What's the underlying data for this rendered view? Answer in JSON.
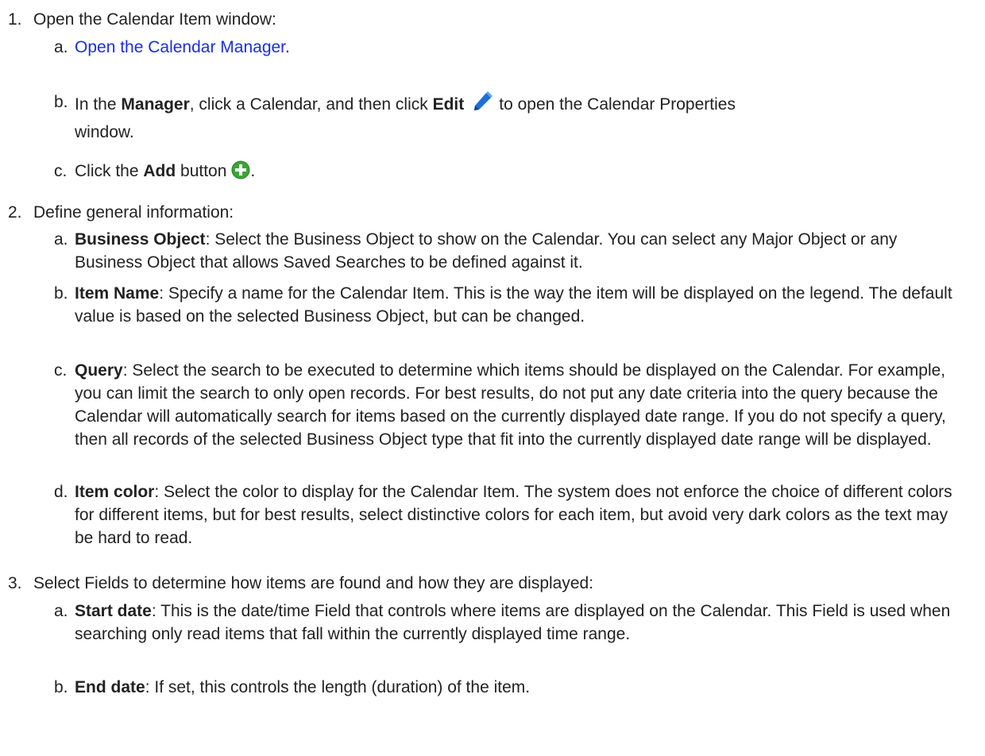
{
  "steps": [
    {
      "num": "1.",
      "title": "Open the Calendar Item window:",
      "items": [
        {
          "label": "a.",
          "link": "Open the Calendar Manager",
          "after": "."
        },
        {
          "label": "b.",
          "t1": "In the ",
          "b1": "Manager",
          "t2": ", click a Calendar, and then click ",
          "b2": "Edit",
          "t3": "to open the Calendar Properties",
          "t4": "window.",
          "icon": "edit-pencil-icon"
        },
        {
          "label": "c.",
          "t1": "Click the ",
          "b1": "Add",
          "t2": " button",
          "after": ".",
          "icon": "add-plus-icon"
        }
      ]
    },
    {
      "num": "2.",
      "title": "Define general information:",
      "items": [
        {
          "label": "a.",
          "term": "Business Object",
          "text": ": Select the Business Object to show on the Calendar. You can select any Major Object or any Business Object that allows Saved Searches to be defined against it."
        },
        {
          "label": "b.",
          "term": "Item Name",
          "text": ": Specify a name for the Calendar Item. This is the way the item will be displayed on the legend. The default value is based on the selected Business Object, but can be changed."
        },
        {
          "label": "c.",
          "term": "Query",
          "text": ": Select the search to be executed to determine which items should be displayed on the Calendar. For example, you can limit the search to only open records. For best results, do not put any date criteria into the query because the Calendar will automatically search for items based on the currently displayed date range. If you do not specify a query, then all records of the selected Business Object type that fit into the currently displayed date range will be displayed."
        },
        {
          "label": "d.",
          "term": "Item color",
          "text": ": Select the color to display for the Calendar Item. The system does not enforce the choice of different colors for different items, but for best results, select distinctive colors for each item, but avoid very dark colors as the text may be hard to read."
        }
      ]
    },
    {
      "num": "3.",
      "title": "Select Fields to determine how items are found and how they are displayed:",
      "items": [
        {
          "label": "a.",
          "term": "Start date",
          "text": ": This is the date/time Field that controls where items are displayed on the Calendar. This Field is used when searching only read items that fall within the currently displayed time range."
        },
        {
          "label": "b.",
          "term": "End date",
          "text": ": If set, this controls the length (duration) of the item."
        }
      ]
    }
  ],
  "colors": {
    "link": "#1a2fe0",
    "text": "#222222",
    "icon_blue": "#1f6fd8",
    "icon_green": "#3aa635"
  }
}
